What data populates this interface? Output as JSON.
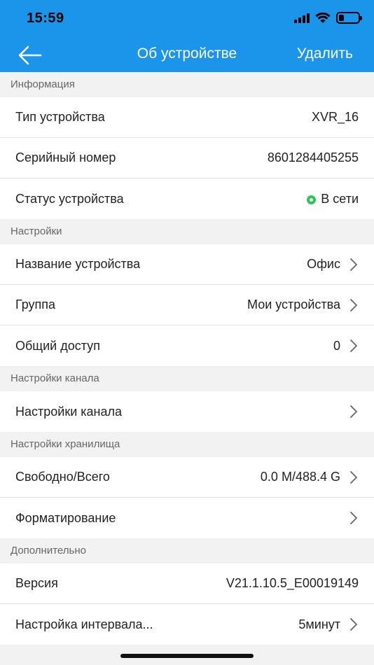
{
  "status_bar": {
    "time": "15:59",
    "battery_percent": 25
  },
  "nav": {
    "title": "Об устройстве",
    "delete_label": "Удалить"
  },
  "colors": {
    "header": "#1a95ea",
    "online": "#2ec45a"
  },
  "sections": {
    "info": {
      "title": "Информация",
      "device_type_label": "Тип устройства",
      "device_type_value": "XVR_16",
      "serial_label": "Серийный номер",
      "serial_value": "8601284405255",
      "status_label": "Статус устройства",
      "status_value": "В сети"
    },
    "settings": {
      "title": "Настройки",
      "name_label": "Название устройства",
      "name_value": "Офис",
      "group_label": "Группа",
      "group_value": "Мои устройства",
      "share_label": "Общий доступ",
      "share_value": "0"
    },
    "channel": {
      "title": "Настройки канала",
      "channel_label": "Настройки канала"
    },
    "storage": {
      "title": "Настройки хранилища",
      "free_label": "Свободно/Всего",
      "free_value": "0.0 M/488.4 G",
      "format_label": "Форматирование"
    },
    "extra": {
      "title": "Дополнительно",
      "version_label": "Версия",
      "version_value": "V21.1.10.5_E00019149",
      "interval_label": "Настройка интервала...",
      "interval_value": "5минут"
    }
  },
  "icons": {
    "back": "arrow-left-icon",
    "chevron": "chevron-right-icon",
    "wifi": "wifi-icon",
    "signal": "signal-icon",
    "battery": "battery-icon"
  }
}
